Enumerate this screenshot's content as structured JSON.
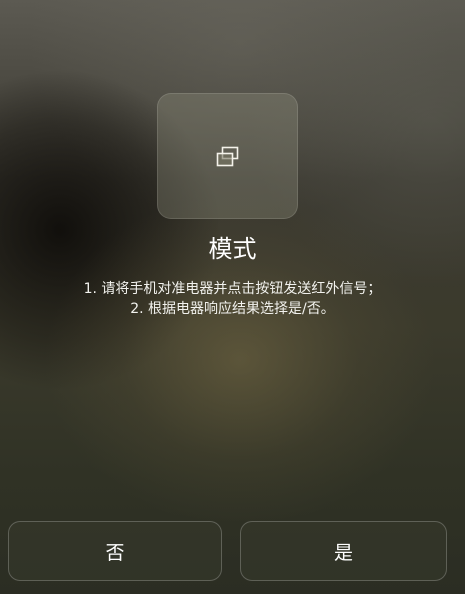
{
  "mode_card": {
    "icon": "copy-windows-icon"
  },
  "title": "模式",
  "instructions": {
    "line1": "1. 请将手机对准电器并点击按钮发送红外信号；",
    "line2": "2. 根据电器响应结果选择是/否。"
  },
  "buttons": {
    "no_label": "否",
    "yes_label": "是"
  }
}
